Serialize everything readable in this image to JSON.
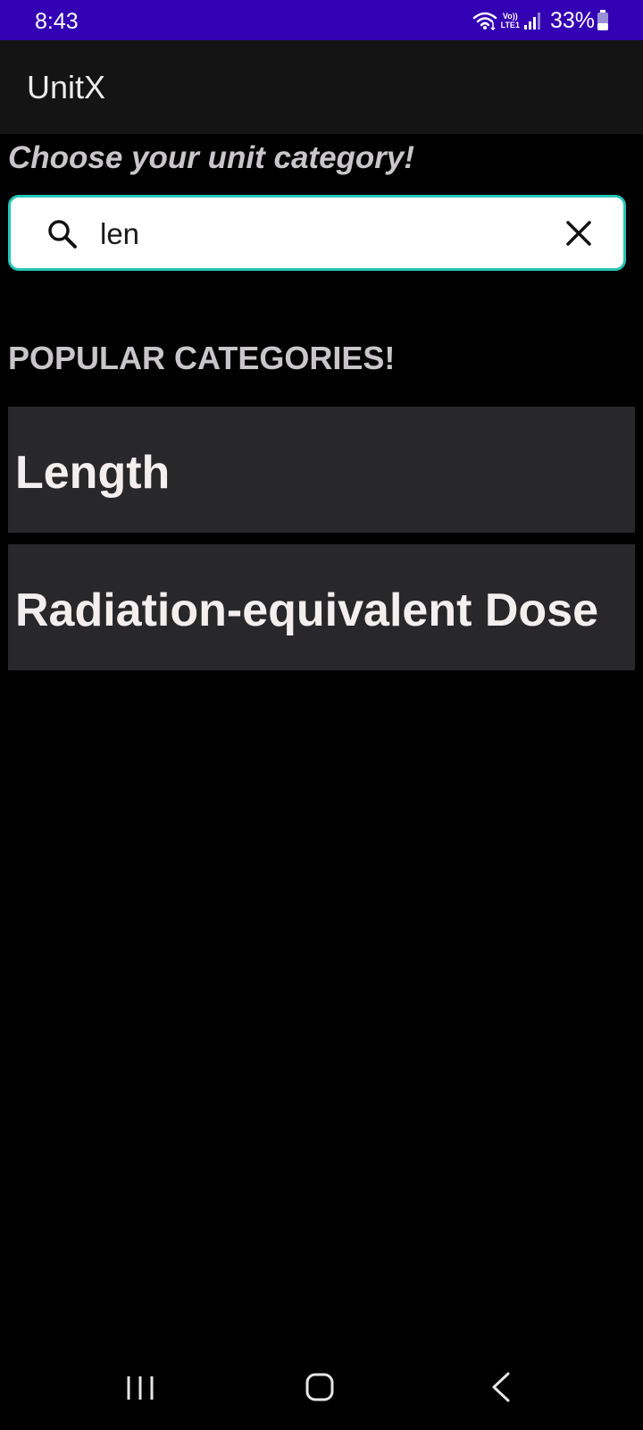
{
  "status_bar": {
    "time": "8:43",
    "network_label_top": "Vo))",
    "network_label_bottom": "LTE1",
    "battery": "33%",
    "wifi_icon": "wifi-icon",
    "signal_icon": "signal-bars-icon",
    "battery_icon": "battery-icon"
  },
  "app_bar": {
    "title": "UnitX"
  },
  "main": {
    "subtitle": "Choose your unit category!",
    "search": {
      "value": "len",
      "search_icon": "search-icon",
      "clear_icon": "close-icon"
    },
    "section_heading": "POPULAR CATEGORIES!",
    "categories": [
      {
        "label": "Length"
      },
      {
        "label": "Radiation-equivalent Dose"
      }
    ]
  },
  "nav_bar": {
    "recents_icon": "recents-icon",
    "home_icon": "home-icon",
    "back_icon": "back-icon"
  },
  "colors": {
    "status_bar": "#3300b3",
    "app_bar": "#141414",
    "background": "#000000",
    "search_border": "#26c6b8",
    "card_background": "#282729",
    "card_text": "#f3efef",
    "muted_text": "#c8c6c8"
  }
}
